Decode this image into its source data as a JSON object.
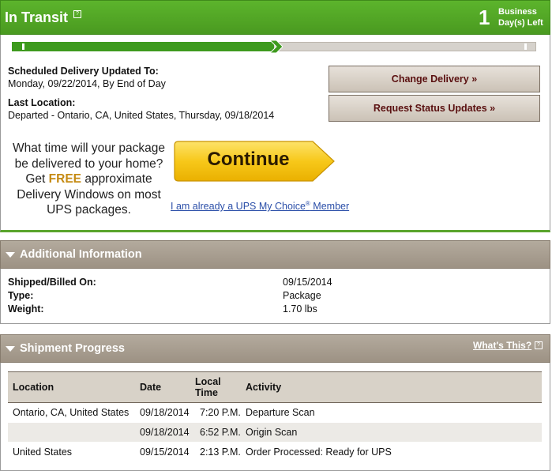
{
  "header": {
    "title": "In Transit",
    "days_count": "1",
    "days_label_line1": "Business",
    "days_label_line2": "Day(s) Left",
    "color": "#4fa826"
  },
  "progress": {
    "fraction": 0.5
  },
  "delivery": {
    "scheduled_label": "Scheduled Delivery Updated To:",
    "scheduled_value": "Monday, 09/22/2014, By End of Day",
    "last_location_label": "Last Location:",
    "last_location_value": "Departed - Ontario, CA, United States, Thursday, 09/18/2014"
  },
  "buttons": {
    "change_delivery": "Change Delivery »",
    "request_updates": "Request Status Updates »"
  },
  "promo": {
    "line1": "What time will your package",
    "line2": "be delivered to your home?",
    "get": "Get ",
    "free": "FREE",
    "line3_rest": " approximate",
    "line4": "Delivery Windows on most",
    "line5": "UPS packages.",
    "continue": "Continue",
    "member_link": "I am already a UPS My Choice",
    "member_reg": "®",
    "member_suffix": " Member"
  },
  "additional_info": {
    "title": "Additional Information",
    "rows": [
      {
        "label": "Shipped/Billed On:",
        "value": "09/15/2014"
      },
      {
        "label": "Type:",
        "value": "Package"
      },
      {
        "label": "Weight:",
        "value": "1.70 lbs"
      }
    ]
  },
  "shipment_progress": {
    "title": "Shipment Progress",
    "whats_this": "What's This?",
    "columns": [
      "Location",
      "Date",
      "Local Time",
      "Activity"
    ],
    "rows": [
      [
        "Ontario, CA, United States",
        "09/18/2014",
        "7:20 P.M.",
        "Departure Scan"
      ],
      [
        "",
        "09/18/2014",
        "6:52 P.M.",
        "Origin Scan"
      ],
      [
        "United States",
        "09/15/2014",
        "2:13 P.M.",
        "Order Processed: Ready for UPS"
      ]
    ]
  }
}
